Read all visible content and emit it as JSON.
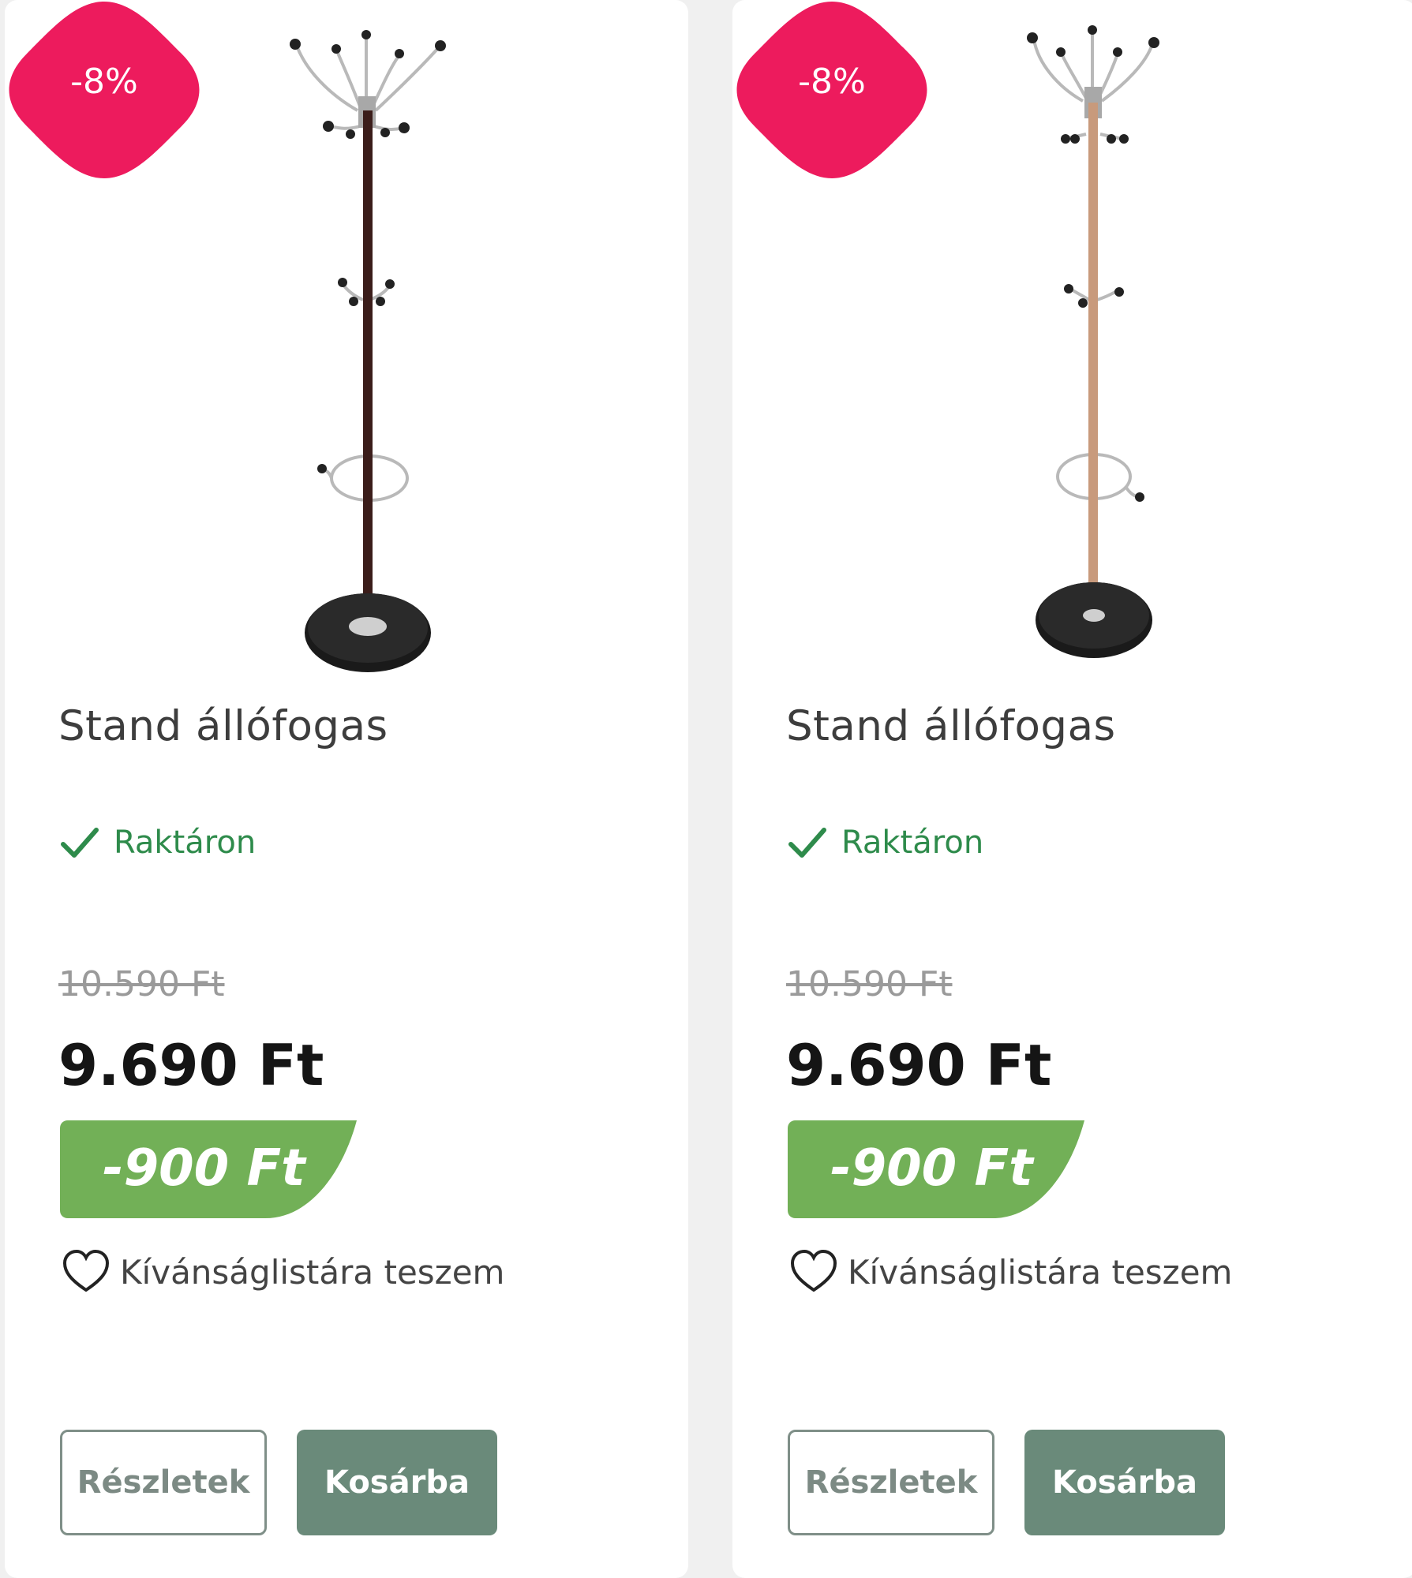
{
  "colors": {
    "badge": "#ed1b5d",
    "saving_badge": "#72b057",
    "in_stock": "#2e8b4b",
    "cart_button": "#6a8a7a",
    "pole_dark": "#3b1d1a",
    "pole_light": "#c89a7c"
  },
  "products": [
    {
      "discount_badge": "-8%",
      "image_icon": "coat-stand-dark-image",
      "pole_color": "#3b1d1a",
      "title": "Stand állófogas",
      "stock_icon": "check-icon",
      "stock_label": "Raktáron",
      "old_price": "10.590 Ft",
      "price": "9.690 Ft",
      "saving": "-900 Ft",
      "wishlist_icon": "heart-outline-icon",
      "wishlist_label": "Kívánságlistára teszem",
      "details_button": "Részletek",
      "cart_button": "Kosárba"
    },
    {
      "discount_badge": "-8%",
      "image_icon": "coat-stand-light-image",
      "pole_color": "#c89a7c",
      "title": "Stand állófogas",
      "stock_icon": "check-icon",
      "stock_label": "Raktáron",
      "old_price": "10.590 Ft",
      "price": "9.690 Ft",
      "saving": "-900 Ft",
      "wishlist_icon": "heart-outline-icon",
      "wishlist_label": "Kívánságlistára teszem",
      "details_button": "Részletek",
      "cart_button": "Kosárba"
    }
  ]
}
